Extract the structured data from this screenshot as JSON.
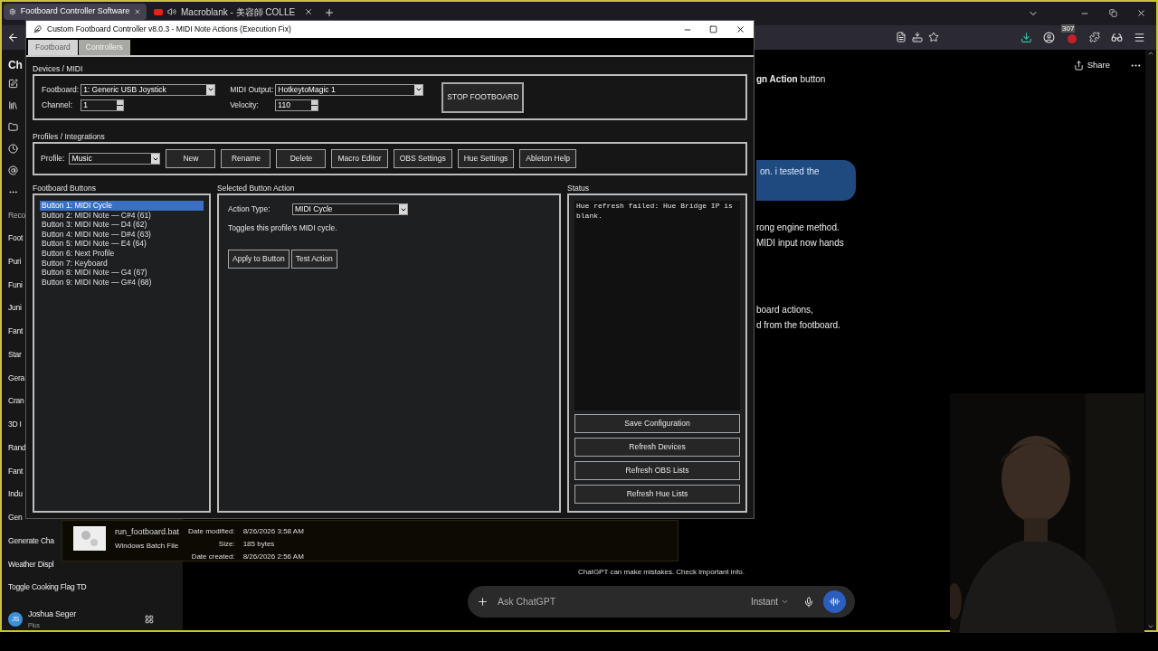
{
  "browser": {
    "tabs": [
      {
        "title": "Footboard Controller Software",
        "selected": true,
        "kind": "settings"
      },
      {
        "title": "Macroblank - 美容師 COLLE",
        "selected": false,
        "kind": "video"
      }
    ],
    "badge": "307"
  },
  "chat_sidebar": {
    "heading": "Ch",
    "section": "Reco",
    "items": [
      "Foot",
      "Puri",
      "Funi",
      "Juni",
      "Fant",
      "Star",
      "Gera",
      "Cran",
      "3D I",
      "Rand",
      "Fant",
      "Indu",
      "Gen",
      "Generate Cha",
      "Weather Displ",
      "Toggle Cooking Flag TD"
    ],
    "user": {
      "initials": "JS",
      "name": "Joshua Seger",
      "plan": "Plus"
    }
  },
  "chat": {
    "share": "Share",
    "lines": [
      {
        "kind": "text",
        "text": "**gn Action** button"
      },
      {
        "kind": "bubble",
        "text": "on. i tested the"
      },
      {
        "kind": "text",
        "text": "rong engine method."
      },
      {
        "kind": "text",
        "text": "MIDI input now hands"
      },
      {
        "kind": "text",
        "text": "board actions,"
      },
      {
        "kind": "text",
        "text": "d from the footboard."
      }
    ],
    "disclaimer": "ChatGPT can make mistakes. Check important info.",
    "composer": {
      "placeholder": "Ask ChatGPT",
      "mode": "Instant"
    }
  },
  "app": {
    "title": "Custom Footboard Controller v8.0.3 - MIDI Note Actions (Execution Fix)",
    "tabs": [
      {
        "label": "Footboard",
        "selected": true
      },
      {
        "label": "Controllers",
        "selected": false
      }
    ],
    "devices": {
      "label": "Devices / MIDI",
      "footboard_label": "Footboard:",
      "footboard": "1: Generic USB Joystick",
      "midi_output_label": "MIDI Output:",
      "midi_output": "HotkeytoMagic 1",
      "channel_label": "Channel:",
      "channel": "1",
      "velocity_label": "Velocity:",
      "velocity": "110",
      "stop_button": "STOP FOOTBOARD"
    },
    "profiles": {
      "label": "Profiles / Integrations",
      "profile_label": "Profile:",
      "profile": "Music",
      "buttons": [
        "New",
        "Rename",
        "Delete",
        "Macro Editor",
        "OBS Settings",
        "Hue Settings",
        "Ableton Help"
      ]
    },
    "footboard_buttons": {
      "label": "Footboard Buttons",
      "items": [
        {
          "text": "Button 1: MIDI Cycle",
          "selected": true
        },
        {
          "text": "Button 2: MIDI Note — C#4 (61)",
          "selected": false
        },
        {
          "text": "Button 3: MIDI Note — D4 (62)",
          "selected": false
        },
        {
          "text": "Button 4: MIDI Note — D#4 (63)",
          "selected": false
        },
        {
          "text": "Button 5: MIDI Note — E4 (64)",
          "selected": false
        },
        {
          "text": "Button 6: Next Profile",
          "selected": false
        },
        {
          "text": "Button 7: Keyboard",
          "selected": false
        },
        {
          "text": "Button 8: MIDI Note — G4 (67)",
          "selected": false
        },
        {
          "text": "Button 9: MIDI Note — G#4 (68)",
          "selected": false
        }
      ]
    },
    "action": {
      "label": "Selected Button Action",
      "type_label": "Action Type:",
      "type": "MIDI Cycle",
      "description": "Toggles this profile's MIDI cycle.",
      "buttons": [
        "Apply to Button",
        "Test Action"
      ]
    },
    "status": {
      "label": "Status",
      "text": "Hue refresh failed: Hue Bridge IP is blank.",
      "buttons": [
        "Save Configuration",
        "Refresh Devices",
        "Refresh OBS Lists",
        "Refresh Hue Lists"
      ]
    }
  },
  "file_tooltip": {
    "name": "run_footboard.bat",
    "type": "Windows Batch File",
    "fields": [
      {
        "label": "Date modified:",
        "value": "8/26/2026 3:58 AM"
      },
      {
        "label": "Size:",
        "value": "185 bytes"
      },
      {
        "label": "Date created:",
        "value": "8/26/2026 2:56 AM"
      }
    ]
  }
}
